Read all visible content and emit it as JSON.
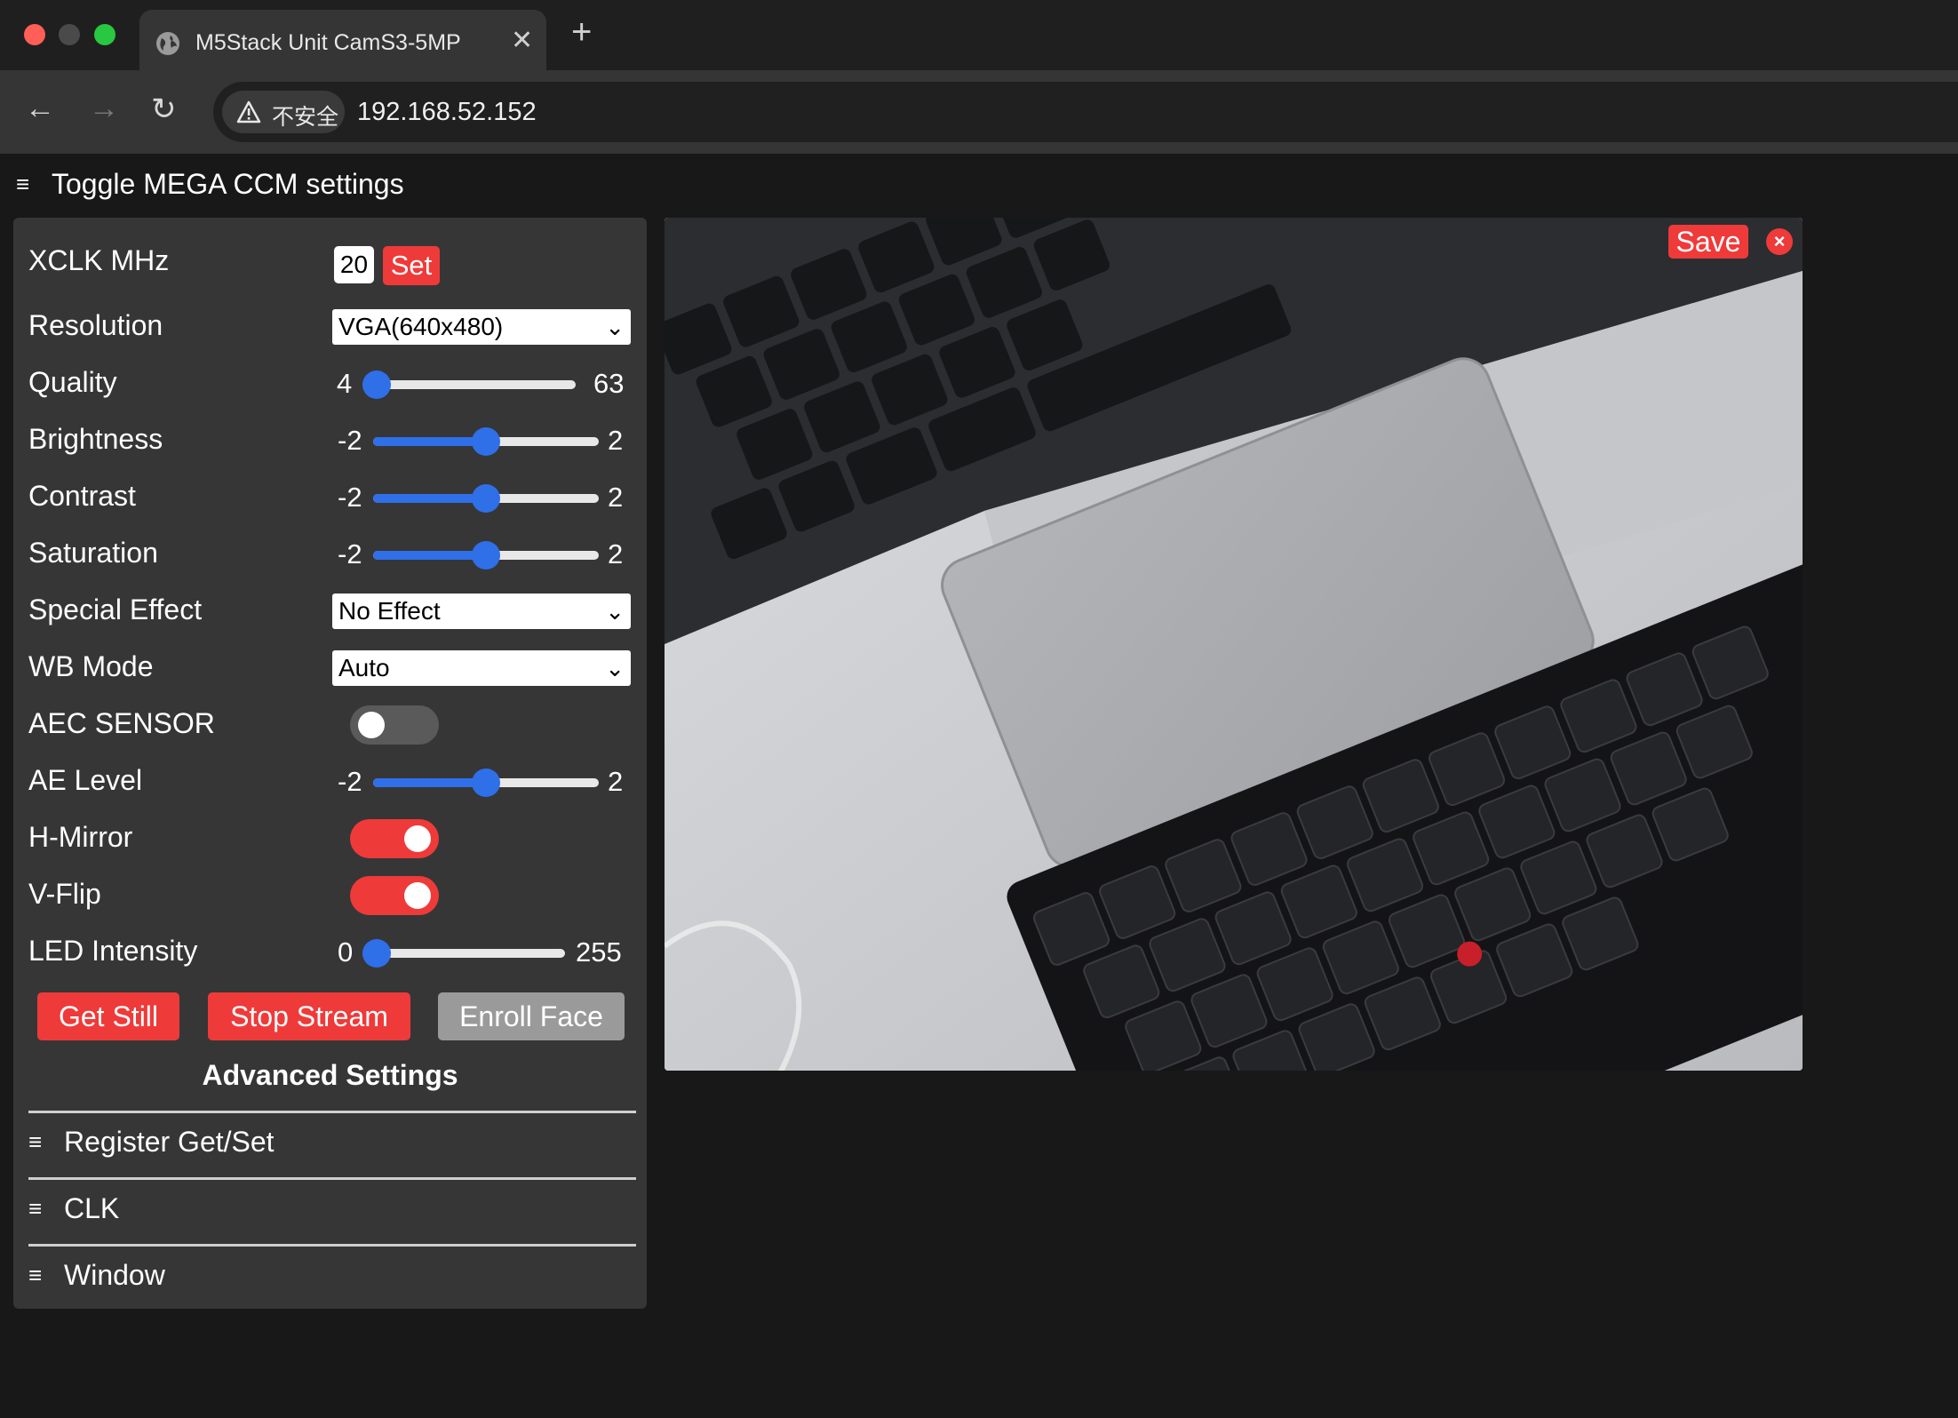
{
  "browser": {
    "tab_title": "M5Stack Unit CamS3-5MP",
    "tab_close": "✕",
    "new_tab": "+",
    "security_label": "不安全",
    "url": "192.168.52.152",
    "back": "←",
    "forward": "→",
    "reload": "↻"
  },
  "page": {
    "toggle_label": "Toggle MEGA CCM settings",
    "menu_glyph": "≡"
  },
  "controls": {
    "xclk": {
      "label": "XCLK MHz",
      "value": "20",
      "set_label": "Set"
    },
    "resolution": {
      "label": "Resolution",
      "selected": "VGA(640x480)"
    },
    "quality": {
      "label": "Quality",
      "min": "4",
      "max": "63",
      "value": 4
    },
    "brightness": {
      "label": "Brightness",
      "min": "-2",
      "max": "2",
      "value": 0
    },
    "contrast": {
      "label": "Contrast",
      "min": "-2",
      "max": "2",
      "value": 0
    },
    "saturation": {
      "label": "Saturation",
      "min": "-2",
      "max": "2",
      "value": 0
    },
    "special_effect": {
      "label": "Special Effect",
      "selected": "No Effect"
    },
    "wb_mode": {
      "label": "WB Mode",
      "selected": "Auto"
    },
    "aec_sensor": {
      "label": "AEC SENSOR",
      "on": false
    },
    "ae_level": {
      "label": "AE Level",
      "min": "-2",
      "max": "2",
      "value": 0
    },
    "h_mirror": {
      "label": "H-Mirror",
      "on": true
    },
    "v_flip": {
      "label": "V-Flip",
      "on": true
    },
    "led_intensity": {
      "label": "LED Intensity",
      "min": "0",
      "max": "255",
      "value": 0
    }
  },
  "buttons": {
    "get_still": "Get Still",
    "stop_stream": "Stop Stream",
    "enroll_face": "Enroll Face"
  },
  "advanced": {
    "title": "Advanced Settings",
    "sections": [
      "Register Get/Set",
      "CLK",
      "Window"
    ]
  },
  "stream": {
    "save_label": "Save",
    "close_glyph": "×"
  },
  "colors": {
    "accent_red": "#ef3a3a",
    "slider_blue": "#2f6fe8",
    "panel_bg": "#363636",
    "page_bg": "#181818"
  }
}
